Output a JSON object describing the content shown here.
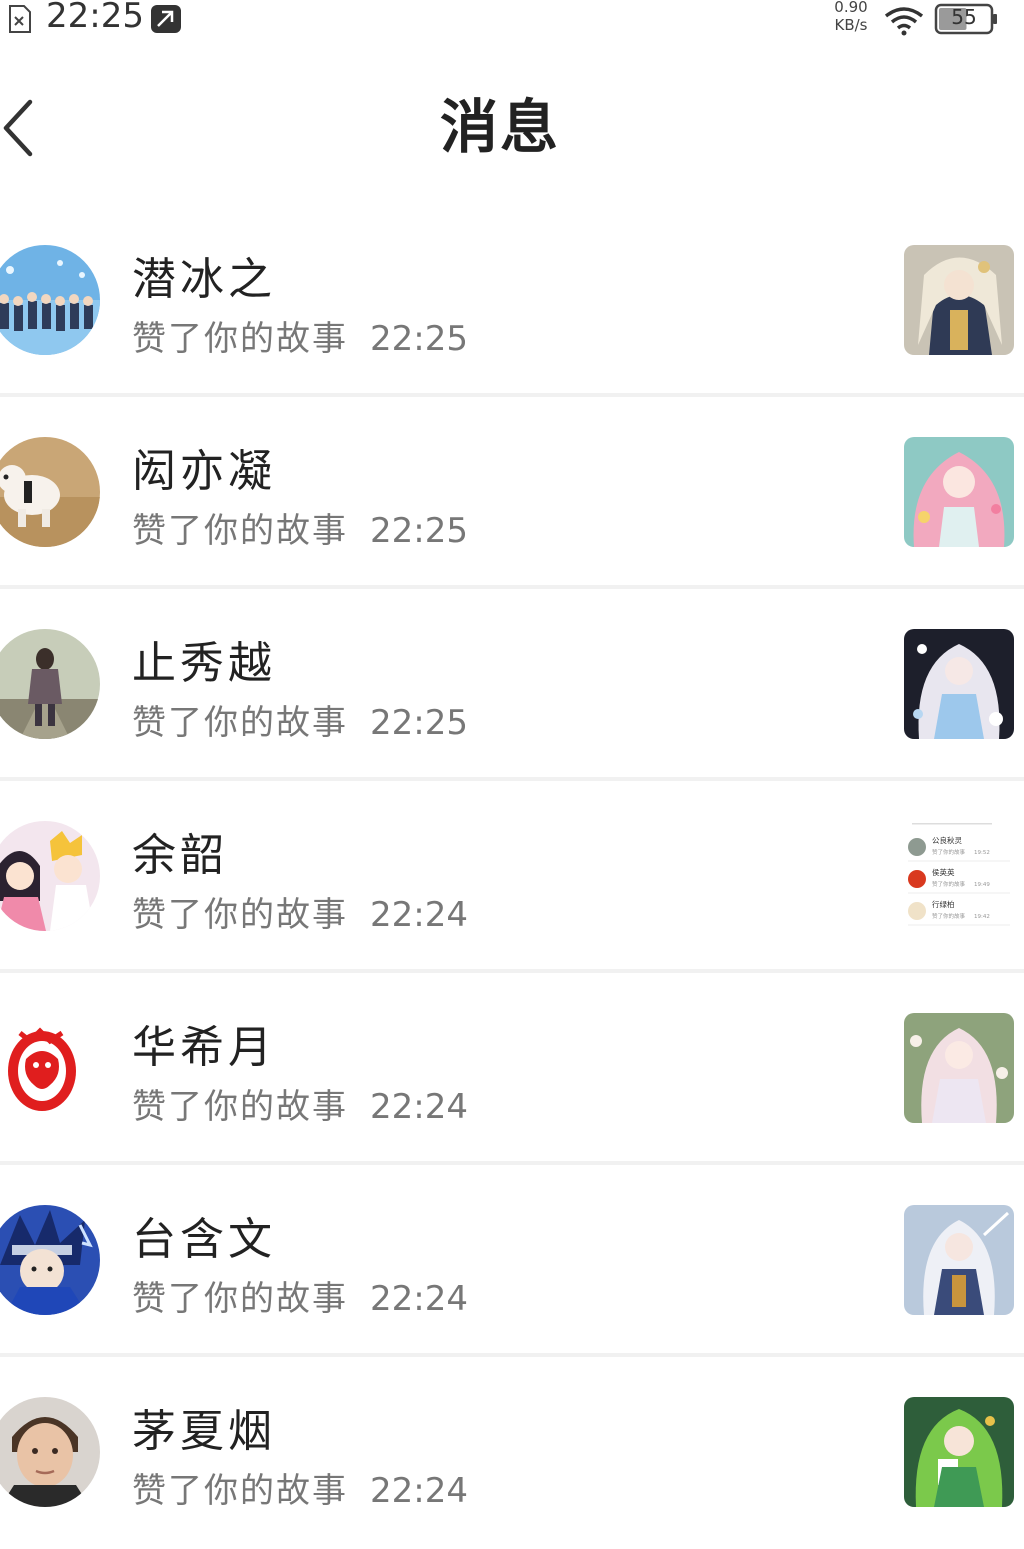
{
  "status_bar": {
    "time": "22:25",
    "net_speed_value": "0.90",
    "net_speed_unit": "KB/s",
    "battery_level": "55"
  },
  "header": {
    "title": "消息"
  },
  "messages": [
    {
      "name": "潜冰之",
      "action": "赞了你的故事",
      "time": "22:25"
    },
    {
      "name": "闳亦凝",
      "action": "赞了你的故事",
      "time": "22:25"
    },
    {
      "name": "止秀越",
      "action": "赞了你的故事",
      "time": "22:25"
    },
    {
      "name": "余韶",
      "action": "赞了你的故事",
      "time": "22:24"
    },
    {
      "name": "华希月",
      "action": "赞了你的故事",
      "time": "22:24"
    },
    {
      "name": "台含文",
      "action": "赞了你的故事",
      "time": "22:24"
    },
    {
      "name": "茅夏烟",
      "action": "赞了你的故事",
      "time": "22:24"
    }
  ],
  "mini_list_preview": [
    {
      "name": "公良秋灵",
      "action": "赞了你的故事",
      "time": "19:52"
    },
    {
      "name": "侯英英",
      "action": "赞了你的故事",
      "time": "19:49"
    },
    {
      "name": "行绿柏",
      "action": "赞了你的故事",
      "time": "19:42"
    }
  ],
  "colors": {
    "divider": "#f1f1f1",
    "name_text": "#222222",
    "secondary_text": "#777777"
  }
}
